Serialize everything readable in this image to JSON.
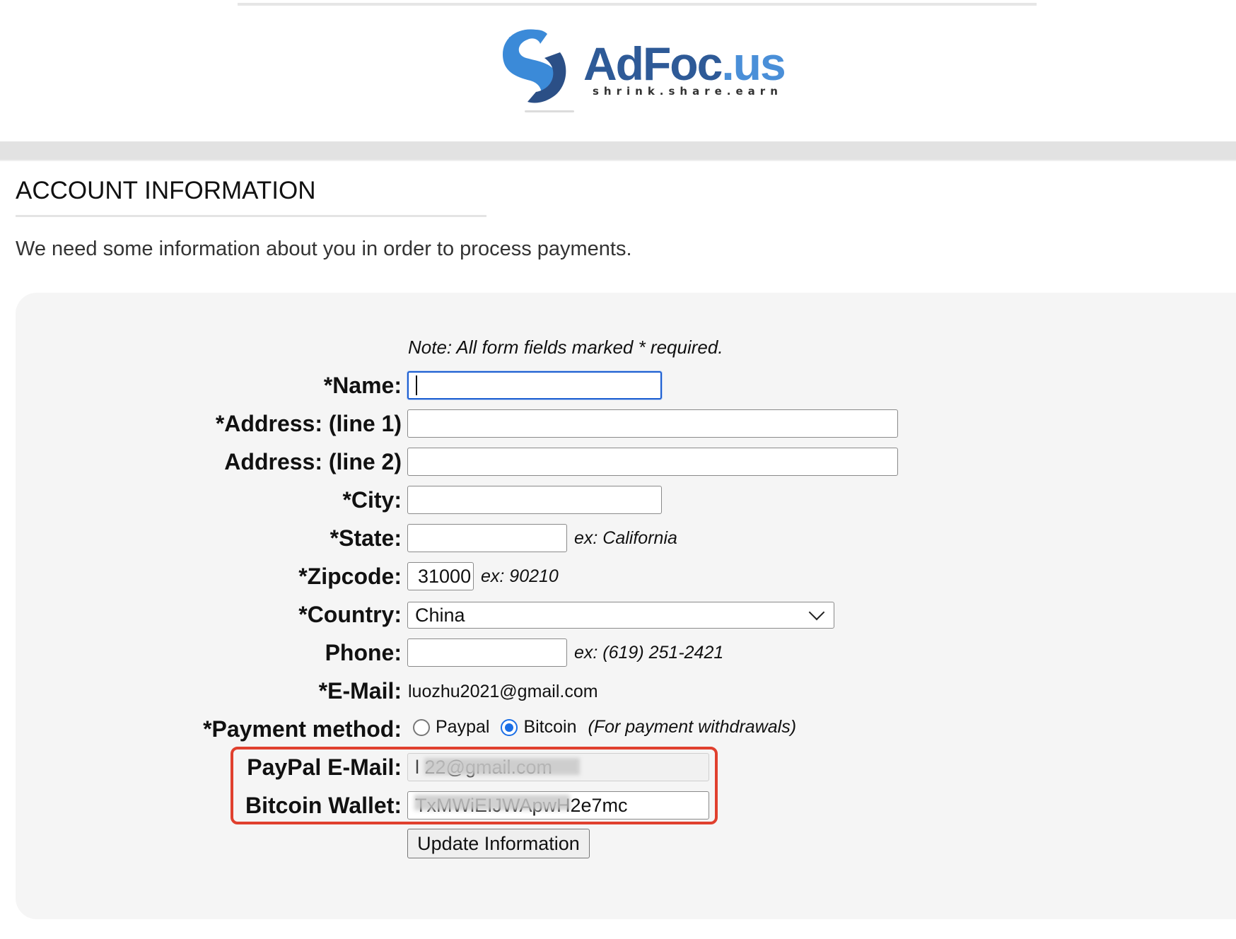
{
  "header": {
    "logo_main": "AdFoc",
    "logo_suffix": ".us",
    "logo_tagline": "shrink.share.earn"
  },
  "page": {
    "title": "ACCOUNT INFORMATION",
    "intro": "We need some information about you in order to process payments."
  },
  "form": {
    "note": "Note: All form fields marked * required.",
    "name": {
      "label": "*Name:",
      "value": ""
    },
    "address1": {
      "label": "*Address: (line 1)",
      "value": ""
    },
    "address2": {
      "label": "Address: (line 2)",
      "value": ""
    },
    "city": {
      "label": "*City:",
      "value": ""
    },
    "state": {
      "label": "*State:",
      "value": "",
      "hint": "ex: California"
    },
    "zipcode": {
      "label": "*Zipcode:",
      "value": "31000",
      "hint": "ex: 90210"
    },
    "country": {
      "label": "*Country:",
      "selected": "China"
    },
    "phone": {
      "label": "Phone:",
      "value": "",
      "hint": "ex: (619) 251-2421"
    },
    "email": {
      "label": "*E-Mail:",
      "value": "luozhu2021@gmail.com"
    },
    "payment_method": {
      "label": "*Payment method:",
      "options": [
        "Paypal",
        "Bitcoin"
      ],
      "selected": "Bitcoin",
      "note": "(For payment withdrawals)"
    },
    "paypal_email": {
      "label": "PayPal E-Mail:",
      "value": "l      22@gmail.com"
    },
    "bitcoin_wallet": {
      "label": "Bitcoin Wallet:",
      "value": "          TxMWiEIJWApwH2e7mc"
    },
    "submit_label": "Update Information"
  },
  "colors": {
    "focus_border": "#1d5fd1",
    "highlight_box": "#e0402e",
    "radio_checked": "#1a6ee6",
    "logo_dark": "#2e5a97",
    "logo_light": "#4a8fd8"
  }
}
